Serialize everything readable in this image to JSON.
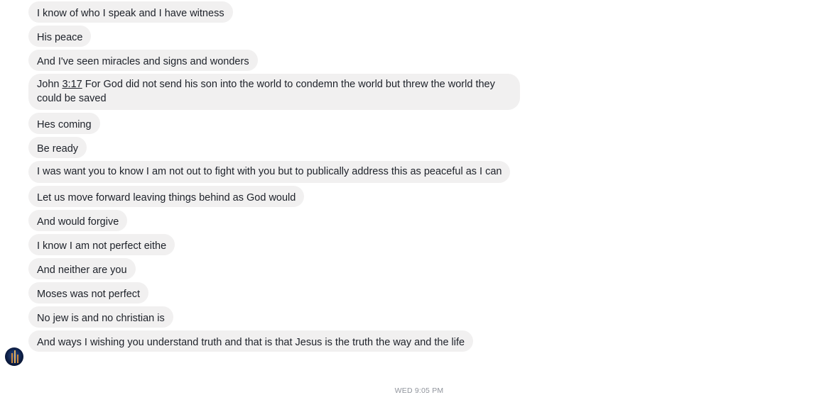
{
  "messages": [
    {
      "text": "I know of who I speak and I have witness"
    },
    {
      "text": "His peace"
    },
    {
      "text": "And I've seen miracles and signs and wonders"
    },
    {
      "prefix": "John ",
      "ref": "3:17",
      "text": " For God did not send his son into the world to condemn the world but threw the world they could be saved"
    },
    {
      "text": "Hes coming"
    },
    {
      "text": "Be ready"
    },
    {
      "text": "I was want you to know I am not out to fight with you but to publically address this as peaceful as I can"
    },
    {
      "text": "Let us move forward leaving things behind as God would"
    },
    {
      "text": "And would forgive"
    },
    {
      "text": "I know I am not perfect eithe"
    },
    {
      "text": "And neither are you"
    },
    {
      "text": "Moses was not perfect"
    },
    {
      "text": "No jew is and no christian is"
    },
    {
      "text": "And ways I wishing you understand truth and that is that Jesus is the truth the way and the life"
    }
  ],
  "timestamp": "WED 9:05 PM",
  "avatar_icon": "sender-avatar"
}
